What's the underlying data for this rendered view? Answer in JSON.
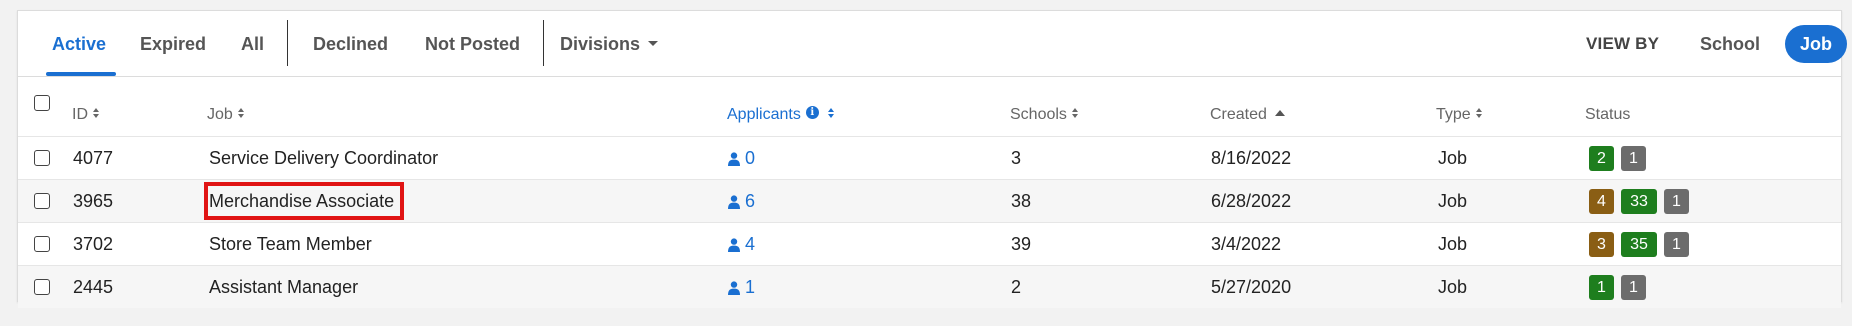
{
  "tabs": {
    "active": "Active",
    "expired": "Expired",
    "all": "All",
    "declined": "Declined",
    "not_posted": "Not Posted",
    "divisions": "Divisions"
  },
  "view_by": {
    "label": "VIEW BY",
    "school": "School",
    "job": "Job"
  },
  "columns": {
    "id": "ID",
    "job": "Job",
    "applicants": "Applicants",
    "schools": "Schools",
    "created": "Created",
    "type": "Type",
    "status": "Status"
  },
  "rows": [
    {
      "id": "4077",
      "job": "Service Delivery Coordinator",
      "applicants": "0",
      "schools": "3",
      "created": "8/16/2022",
      "type": "Job",
      "badges": [
        {
          "text": "2",
          "color": "green"
        },
        {
          "text": "1",
          "color": "gray"
        }
      ]
    },
    {
      "id": "3965",
      "job": "Merchandise Associate",
      "applicants": "6",
      "schools": "38",
      "created": "6/28/2022",
      "type": "Job",
      "highlighted": true,
      "badges": [
        {
          "text": "4",
          "color": "gold"
        },
        {
          "text": "33",
          "color": "green"
        },
        {
          "text": "1",
          "color": "gray"
        }
      ]
    },
    {
      "id": "3702",
      "job": "Store Team Member",
      "applicants": "4",
      "schools": "39",
      "created": "3/4/2022",
      "type": "Job",
      "badges": [
        {
          "text": "3",
          "color": "gold"
        },
        {
          "text": "35",
          "color": "green"
        },
        {
          "text": "1",
          "color": "gray"
        }
      ]
    },
    {
      "id": "2445",
      "job": "Assistant Manager",
      "applicants": "1",
      "schools": "2",
      "created": "5/27/2020",
      "type": "Job",
      "badges": [
        {
          "text": "1",
          "color": "green"
        },
        {
          "text": "1",
          "color": "gray"
        }
      ]
    }
  ],
  "colors": {
    "accent": "#1a6fd1",
    "badge_green": "#1e7e1e",
    "badge_gray": "#6c6c6c",
    "badge_gold": "#8a5e14",
    "highlight": "#e01414"
  }
}
